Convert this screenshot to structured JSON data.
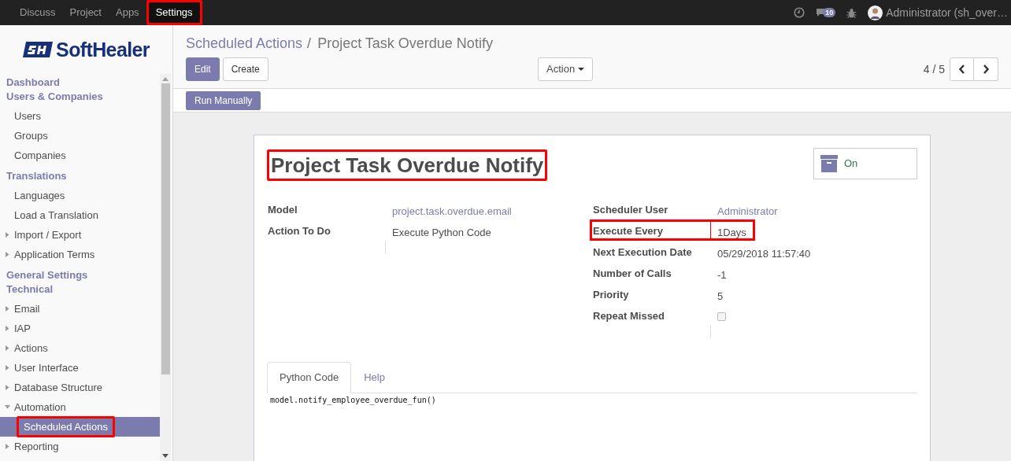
{
  "top_menu": [
    {
      "label": "Discuss",
      "selected": false,
      "highlighted": false
    },
    {
      "label": "Project",
      "selected": false,
      "highlighted": false
    },
    {
      "label": "Apps",
      "selected": false,
      "highlighted": false
    },
    {
      "label": "Settings",
      "selected": true,
      "highlighted": true
    }
  ],
  "systray": {
    "message_count": "10",
    "user": "Administrator (sh_over…"
  },
  "logo": {
    "text": "SoftHealer"
  },
  "sidebar": [
    {
      "label": "Dashboard"
    },
    {
      "label": "Users & Companies",
      "children": [
        {
          "label": "Users",
          "selected": false,
          "highlighted": false
        },
        {
          "label": "Groups",
          "selected": false,
          "highlighted": false
        },
        {
          "label": "Companies",
          "selected": false,
          "highlighted": false
        }
      ]
    },
    {
      "label": "Translations",
      "children": [
        {
          "label": "Languages",
          "selected": false,
          "highlighted": false
        },
        {
          "label": "Load a Translation",
          "selected": false,
          "highlighted": false
        },
        {
          "label": "Import / Export",
          "expanded": false,
          "selected": false,
          "highlighted": false
        },
        {
          "label": "Application Terms",
          "expanded": false,
          "selected": false,
          "highlighted": false
        }
      ]
    },
    {
      "label": "General Settings"
    },
    {
      "label": "Technical",
      "children": [
        {
          "label": "Email",
          "expanded": false,
          "selected": false,
          "highlighted": false
        },
        {
          "label": "IAP",
          "expanded": false,
          "selected": false,
          "highlighted": false
        },
        {
          "label": "Actions",
          "expanded": false,
          "selected": false,
          "highlighted": false
        },
        {
          "label": "User Interface",
          "expanded": false,
          "selected": false,
          "highlighted": false
        },
        {
          "label": "Database Structure",
          "expanded": false,
          "selected": false,
          "highlighted": false
        },
        {
          "label": "Automation",
          "expanded": true,
          "selected": false,
          "highlighted": false,
          "children": [
            {
              "label": "Scheduled Actions",
              "selected": true,
              "highlighted": true
            }
          ]
        },
        {
          "label": "Reporting",
          "expanded": false,
          "selected": false,
          "highlighted": false
        }
      ]
    }
  ],
  "breadcrumb": [
    {
      "label": "Scheduled Actions",
      "kind": "link"
    },
    {
      "label": "/",
      "kind": "separator"
    },
    {
      "label": "Project Task Overdue Notify",
      "kind": "current"
    }
  ],
  "buttons": [
    {
      "label": "Edit",
      "kind": "primary"
    },
    {
      "label": "Create",
      "kind": "secondary"
    }
  ],
  "action_menu": {
    "label": "Action"
  },
  "pager": {
    "text": "4 / 5"
  },
  "status_buttons": [
    {
      "label": "Run Manually"
    }
  ],
  "record": {
    "title": "Project Task Overdue Notify",
    "title_highlighted": true,
    "active_toggle": {
      "label": "On",
      "active": true
    },
    "left_fields": [
      {
        "label": "Model",
        "value": "project.task.overdue.email",
        "kind": "link",
        "highlighted": false
      },
      {
        "label": "Action To Do",
        "value": "Execute Python Code",
        "kind": "text",
        "highlighted": false
      }
    ],
    "right_fields": [
      {
        "label": "Scheduler User",
        "value": "Administrator",
        "kind": "link",
        "highlighted": false
      },
      {
        "label": "Execute Every",
        "value": "1Days",
        "kind": "text",
        "highlighted": true
      },
      {
        "label": "Next Execution Date",
        "value": "05/29/2018 11:57:40",
        "kind": "text",
        "highlighted": false
      },
      {
        "label": "Number of Calls",
        "value": "-1",
        "kind": "text",
        "highlighted": false
      },
      {
        "label": "Priority",
        "value": "5",
        "kind": "text",
        "highlighted": false
      },
      {
        "label": "Repeat Missed",
        "kind": "checkbox",
        "checked": false,
        "highlighted": false
      }
    ],
    "tabs": [
      {
        "label": "Python Code",
        "selected": true
      },
      {
        "label": "Help",
        "selected": false
      }
    ],
    "code": "model.notify_employee_overdue_fun()"
  }
}
